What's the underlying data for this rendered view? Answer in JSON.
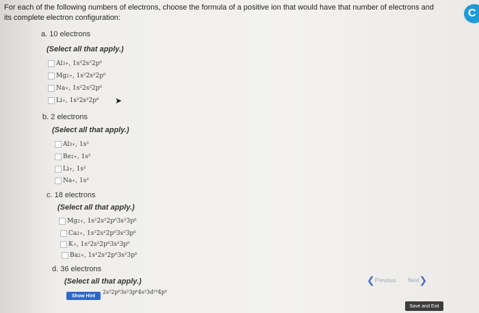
{
  "question": "For each of the following numbers of electrons, choose the formula of a positive ion that would have that number of electrons and its complete electron configuration:",
  "instruction": "(Select all that apply.)",
  "parts": [
    {
      "label": "a. 10 electrons",
      "options": [
        {
          "ion": "Al",
          "charge": "3+",
          "config": "1s²2s²2p⁶"
        },
        {
          "ion": "Mg",
          "charge": "2+",
          "config": "1s²2s²2p⁶"
        },
        {
          "ion": "Na",
          "charge": "+",
          "config": "1s²2s²2p⁶"
        },
        {
          "ion": "Li",
          "charge": "+",
          "config": "1s²2s²2p⁶"
        }
      ]
    },
    {
      "label": "b. 2 electrons",
      "options": [
        {
          "ion": "Al",
          "charge": "3+",
          "config": "1s²"
        },
        {
          "ion": "Be",
          "charge": "2+",
          "config": "1s²"
        },
        {
          "ion": "Li",
          "charge": "+",
          "config": "1s²"
        },
        {
          "ion": "Na",
          "charge": "+",
          "config": "1s²"
        }
      ]
    },
    {
      "label": "c. 18 electrons",
      "options": [
        {
          "ion": "Mg",
          "charge": "2+",
          "config": "1s²2s²2p⁶3s²3p⁶"
        },
        {
          "ion": "Ca",
          "charge": "2+",
          "config": "1s²2s²2p⁶3s²3p⁶"
        },
        {
          "ion": "K",
          "charge": "+",
          "config": "1s²2s²2p⁶3s²3p⁶"
        },
        {
          "ion": "Ba",
          "charge": "2+",
          "config": "1s²2s²2p⁶3s²3p⁶"
        }
      ]
    },
    {
      "label": "d. 36 electrons",
      "options": []
    }
  ],
  "hint_button": "Show Hint",
  "hint_partial": "2s²2p⁶3s²3p⁶4s²3d¹⁰4p⁶",
  "previous_label": "Previous",
  "next_label": "Next",
  "save_label": "Save and Exit",
  "accent_color": "#2f67c8"
}
